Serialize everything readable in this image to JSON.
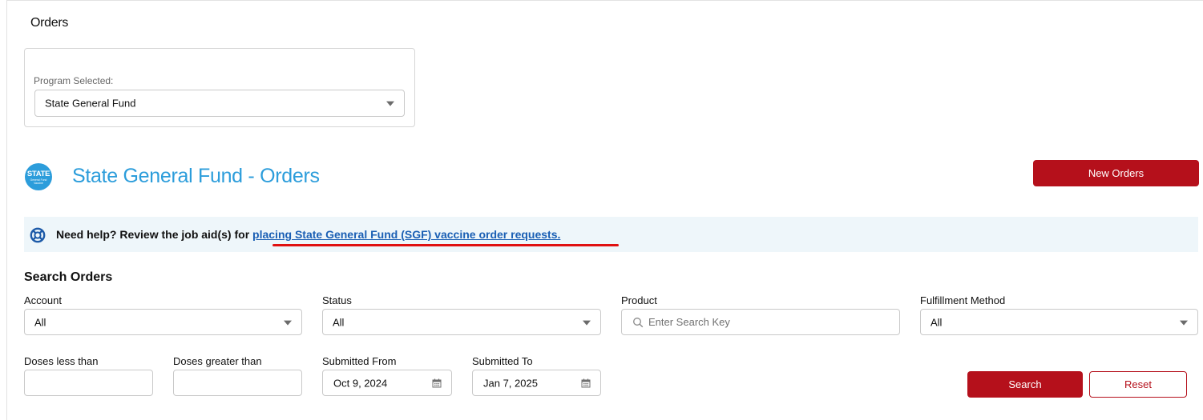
{
  "page": {
    "title": "Orders"
  },
  "program": {
    "label": "Program Selected:",
    "value": "State General Fund"
  },
  "logo": {
    "line1": "STATE",
    "line2": "General Fund",
    "line3": "Vaccine"
  },
  "heading": "State General Fund - Orders",
  "new_orders_label": "New Orders",
  "help": {
    "text": "Need help? Review the job aid(s) for ",
    "link_text": "placing State General Fund (SGF) vaccine order requests."
  },
  "search": {
    "title": "Search Orders",
    "account": {
      "label": "Account",
      "value": "All"
    },
    "status": {
      "label": "Status",
      "value": "All"
    },
    "product": {
      "label": "Product",
      "placeholder": "Enter Search Key"
    },
    "fulfillment": {
      "label": "Fulfillment Method",
      "value": "All"
    },
    "doses_less": {
      "label": "Doses less than",
      "value": ""
    },
    "doses_greater": {
      "label": "Doses greater than",
      "value": ""
    },
    "submitted_from": {
      "label": "Submitted From",
      "value": "Oct 9, 2024"
    },
    "submitted_to": {
      "label": "Submitted To",
      "value": "Jan 7, 2025"
    },
    "search_label": "Search",
    "reset_label": "Reset"
  },
  "colors": {
    "brand_blue": "#2c9ddb",
    "action_red": "#b5101b",
    "banner_bg": "#eef6fa",
    "link_blue": "#1a5fb4",
    "annotation_red": "#e01010"
  },
  "icons": [
    "lifebuoy-icon",
    "search-icon",
    "calendar-icon",
    "chevron-down-icon"
  ]
}
